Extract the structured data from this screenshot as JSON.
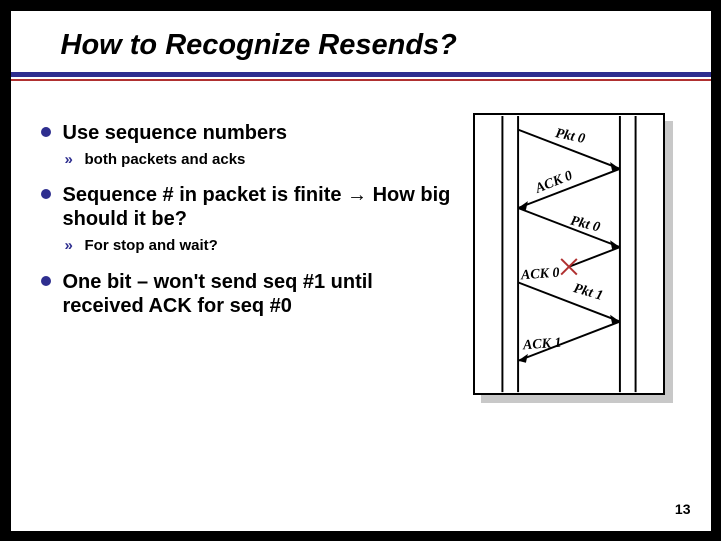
{
  "title": "How to Recognize Resends?",
  "bullets": {
    "b1": "Use sequence numbers",
    "b1_sub1": "both packets and acks",
    "b2_pre": "Sequence # in packet is finite ",
    "b2_arrow": "→",
    "b2_post": " How big should it be?",
    "b2_sub1": "For stop and wait?",
    "b3": "One bit – won't send seq #1 until received ACK for seq #0"
  },
  "diagram": {
    "pkt0_a": "Pkt 0",
    "ack0_a": "ACK 0",
    "pkt0_b": "Pkt 0",
    "ack0_b": "ACK 0",
    "pkt1": "Pkt 1",
    "ack1": "ACK 1"
  },
  "page": "13"
}
